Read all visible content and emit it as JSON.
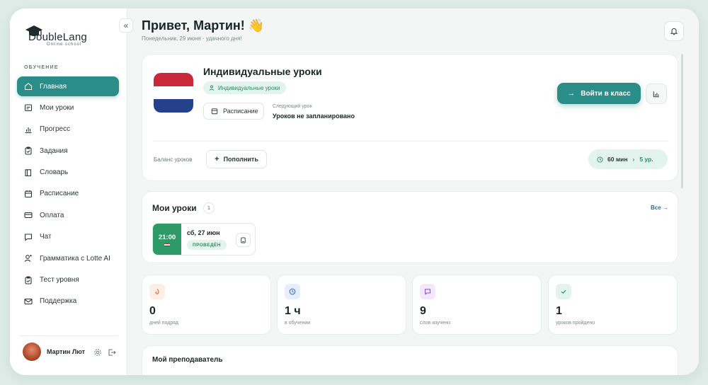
{
  "logo": {
    "name": "DoubleLang",
    "tagline": "Online school"
  },
  "sidebar": {
    "section": "ОБУЧЕНИЕ",
    "items": [
      {
        "label": "Главная",
        "icon": "home-icon",
        "active": true
      },
      {
        "label": "Мои уроки",
        "icon": "calendar-list-icon"
      },
      {
        "label": "Прогресс",
        "icon": "bar-chart-icon"
      },
      {
        "label": "Задания",
        "icon": "clipboard-icon"
      },
      {
        "label": "Словарь",
        "icon": "book-icon"
      },
      {
        "label": "Расписание",
        "icon": "calendar-icon"
      },
      {
        "label": "Оплата",
        "icon": "card-icon"
      },
      {
        "label": "Чат",
        "icon": "chat-icon"
      },
      {
        "label": "Грамматика с Lotte AI",
        "icon": "user-ai-icon"
      },
      {
        "label": "Тест уровня",
        "icon": "test-icon"
      },
      {
        "label": "Поддержка",
        "icon": "mail-icon"
      }
    ],
    "user": {
      "name": "Мартин Лют"
    }
  },
  "header": {
    "greeting": "Привет, Мартин! 👋",
    "subtitle": "Понедельник, 29 июня · удачного дня!"
  },
  "course_card": {
    "title": "Индивидуальные уроки",
    "tag": "Индивидуальные уроки",
    "schedule_btn": "Расписание",
    "next_label": "Следующий урок",
    "next_value": "Уроков не запланировано",
    "enter_btn": "Войти в класс",
    "balance_label": "Баланс уроков",
    "topup_btn": "Пополнить",
    "balance_minutes": "60 мин",
    "balance_lessons": "5 ур.",
    "flag_colors": [
      "#c8283a",
      "#ffffff",
      "#25418c"
    ]
  },
  "lessons_card": {
    "title": "Мои уроки",
    "count": "1",
    "all_link": "Все →",
    "lesson": {
      "time": "21:00",
      "date": "сб, 27 июн",
      "status": "ПРОВЕДЁН"
    }
  },
  "stats": [
    {
      "value": "0",
      "label": "дней подряд",
      "icon": "flame-icon",
      "bg": "#fdeee6",
      "fg": "#e0703a"
    },
    {
      "value": "1 ч",
      "label": "в обучении",
      "icon": "clock-icon",
      "bg": "#e7eefb",
      "fg": "#4a6fc4"
    },
    {
      "value": "9",
      "label": "слов изучено",
      "icon": "chat-bubble-icon",
      "bg": "#f1e8fb",
      "fg": "#9257cf"
    },
    {
      "value": "1",
      "label": "уроков пройдено",
      "icon": "check-icon",
      "bg": "#e3f3ed",
      "fg": "#2e9a68"
    }
  ],
  "teacher_card": {
    "title": "Мой преподаватель"
  }
}
